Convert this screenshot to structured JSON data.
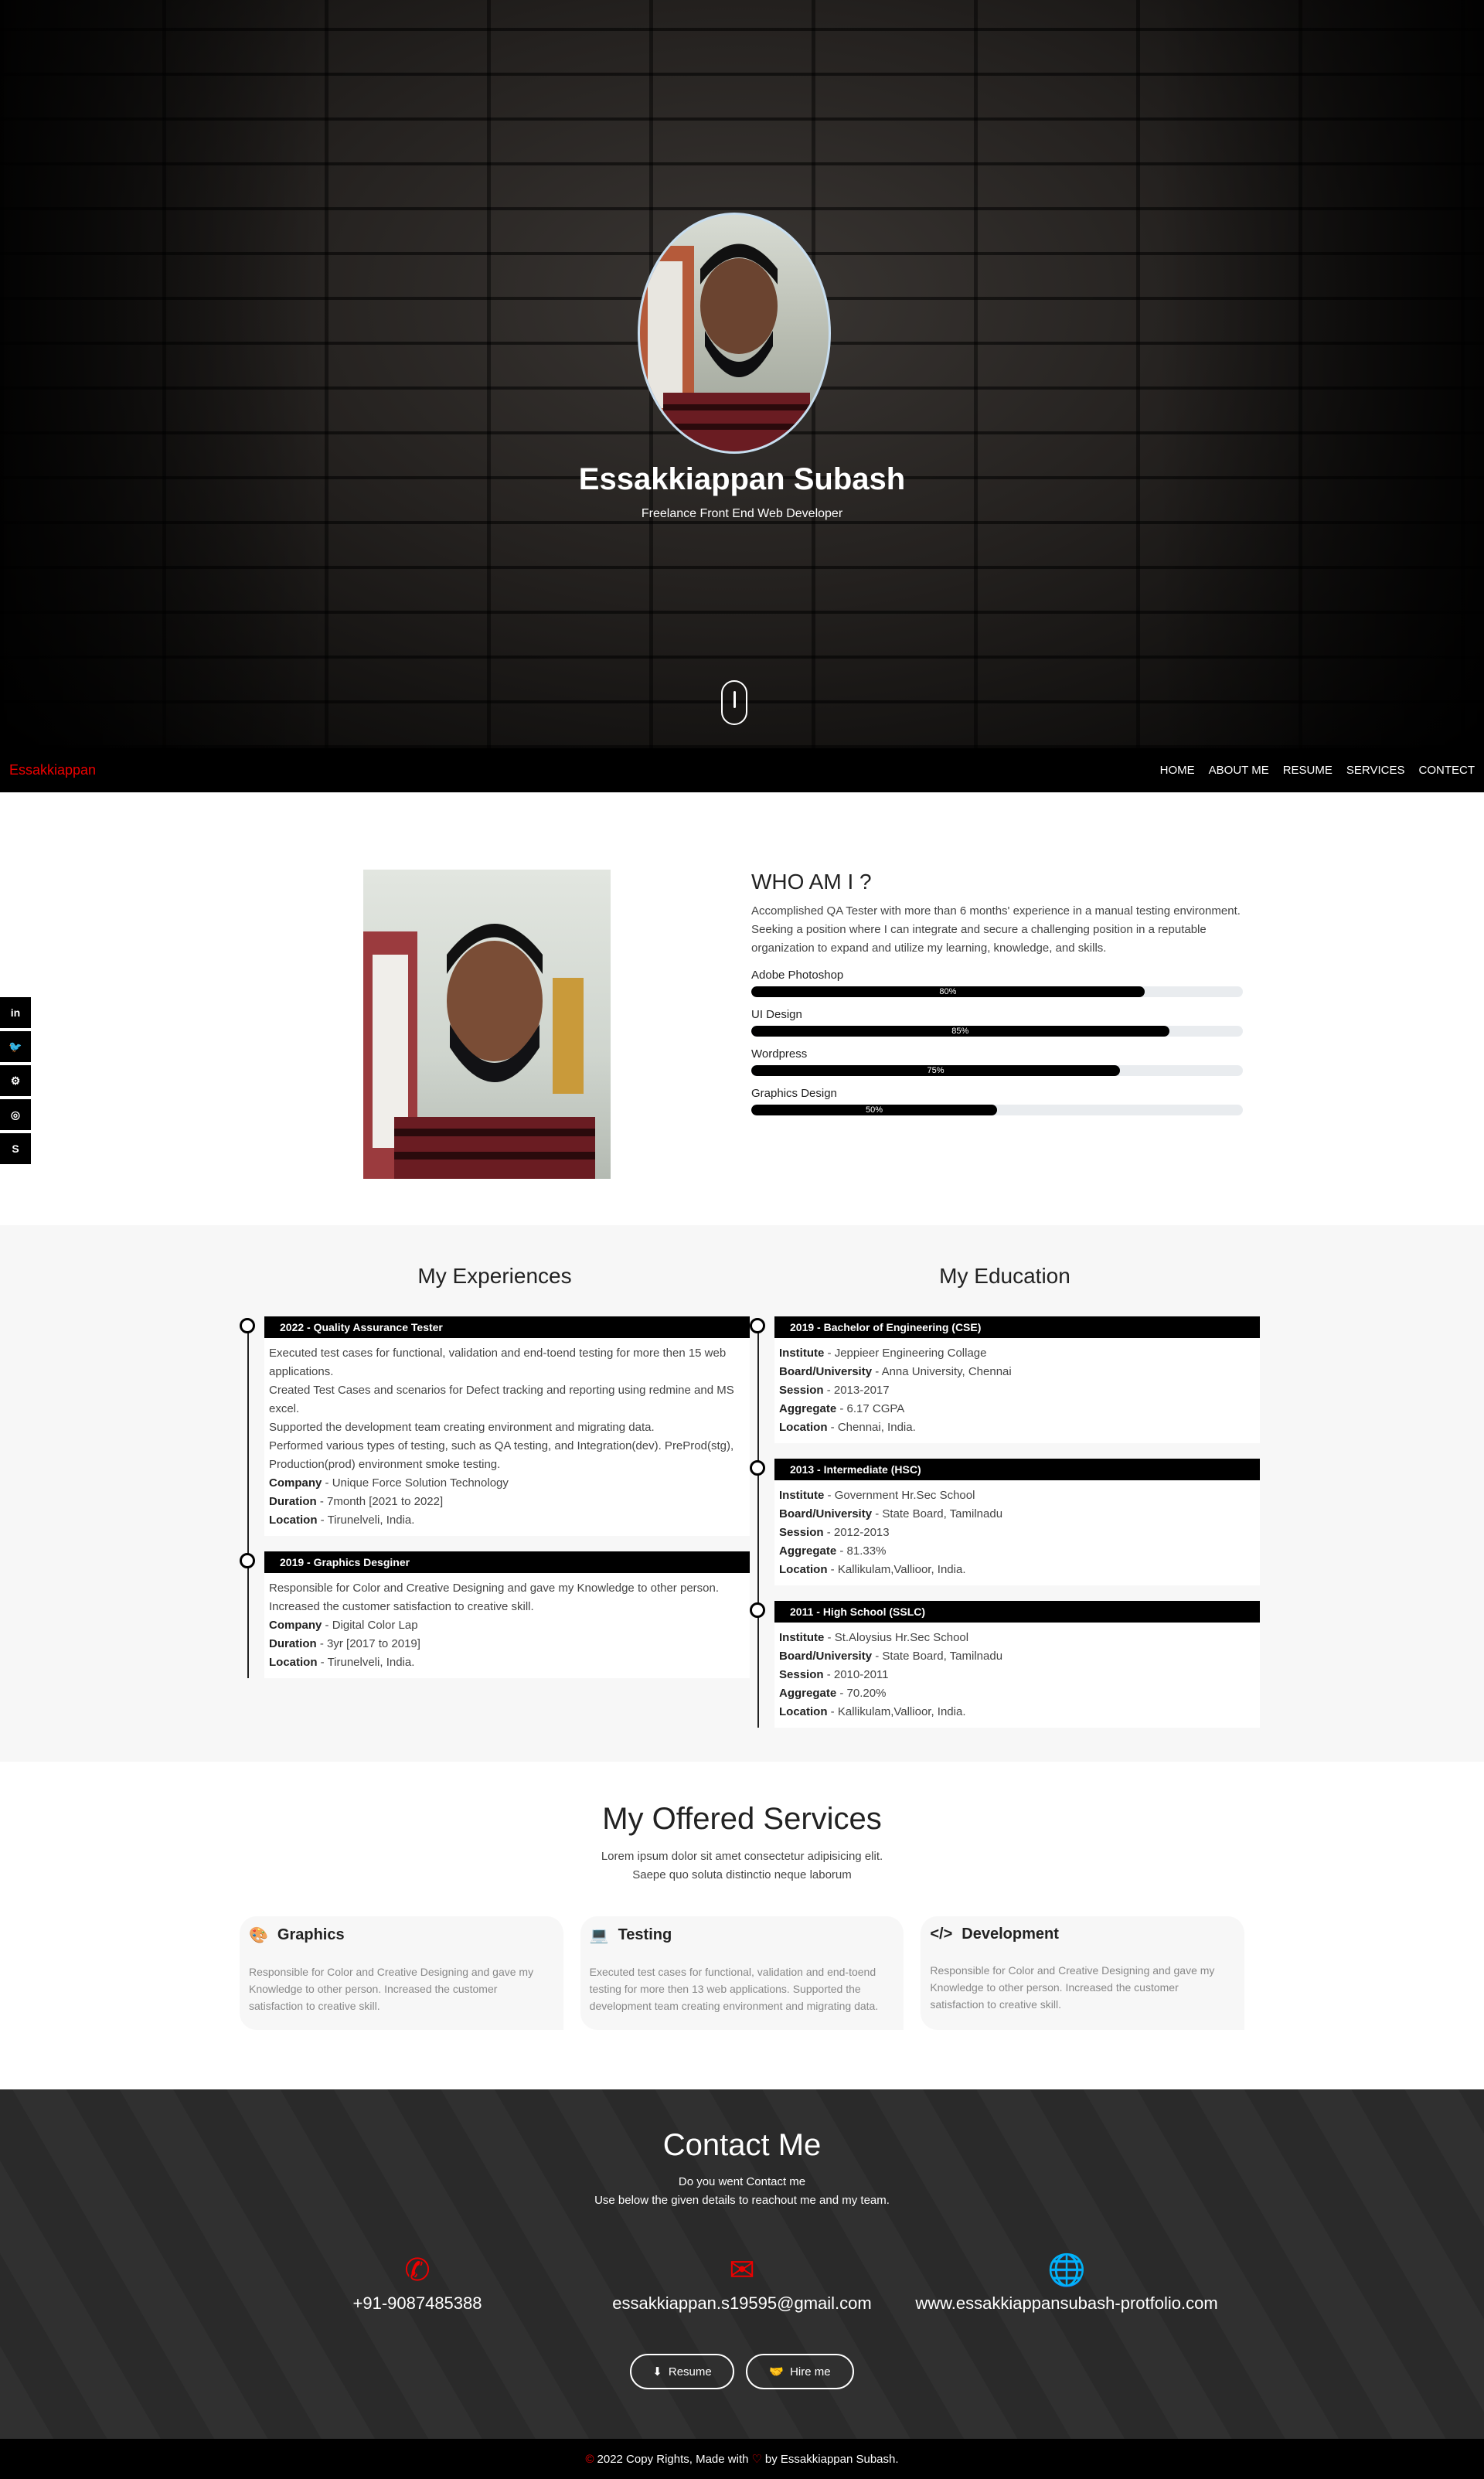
{
  "hero": {
    "name": "Essakkiappan Subash",
    "subtitle": "Freelance Front End Web Developer"
  },
  "nav": {
    "brand": "Essakkiappan",
    "links": [
      "HOME",
      "ABOUT ME",
      "RESUME",
      "SERVICES",
      "CONTECT"
    ]
  },
  "social_icons": [
    "linkedin-icon",
    "twitter-icon",
    "github-icon",
    "instagram-icon",
    "skype-icon"
  ],
  "about": {
    "heading": "WHO AM I ?",
    "paragraph": "Accomplished QA Tester with more than 6 months' experience in a manual testing environment. Seeking a position where I can integrate and secure a challenging position in a reputable organization to expand and utilize my learning, knowledge, and skills.",
    "skills": [
      {
        "name": "Adobe Photoshop",
        "percent": 80,
        "label": "80%"
      },
      {
        "name": "UI Design",
        "percent": 85,
        "label": "85%"
      },
      {
        "name": "Wordpress",
        "percent": 75,
        "label": "75%"
      },
      {
        "name": "Graphics Design",
        "percent": 50,
        "label": "50%"
      }
    ]
  },
  "experience": {
    "heading": "My Experiences",
    "items": [
      {
        "title": "2022 - Quality Assurance Tester",
        "desc": [
          "Executed test cases for functional, validation and end-toend testing for more then 15 web applications.",
          "Created Test Cases and scenarios for Defect tracking and reporting using redmine and MS excel.",
          "Supported the development team creating environment and migrating data.",
          "Performed various types of testing, such as QA testing, and Integration(dev). PreProd(stg), Production(prod) environment smoke testing."
        ],
        "company_label": "Company",
        "company": "Unique Force Solution Technology",
        "duration_label": "Duration",
        "duration": "7month [2021 to 2022]",
        "location_label": "Location",
        "location": "Tirunelveli, India."
      },
      {
        "title": "2019 - Graphics Desginer",
        "desc": [
          "Responsible for Color and Creative Designing and gave my Knowledge to other person.",
          "Increased the customer satisfaction to creative skill."
        ],
        "company_label": "Company",
        "company": "Digital Color Lap",
        "duration_label": "Duration",
        "duration": "3yr [2017 to 2019]",
        "location_label": "Location",
        "location": "Tirunelveli, India."
      }
    ]
  },
  "education": {
    "heading": "My Education",
    "items": [
      {
        "title": "2019 - Bachelor of Engineering (CSE)",
        "institute": "Jeppieer Engineering Collage",
        "board": "Anna University, Chennai",
        "session": "2013-2017",
        "aggregate": "6.17 CGPA",
        "location": "Chennai, India."
      },
      {
        "title": "2013 - Intermediate (HSC)",
        "institute": "Government Hr.Sec School",
        "board": "State Board, Tamilnadu",
        "session": "2012-2013",
        "aggregate": "81.33%",
        "location": "Kallikulam,Vallioor, India."
      },
      {
        "title": "2011 - High School (SSLC)",
        "institute": "St.Aloysius Hr.Sec School",
        "board": "State Board, Tamilnadu",
        "session": "2010-2011",
        "aggregate": "70.20%",
        "location": "Kallikulam,Vallioor, India."
      }
    ],
    "labels": {
      "institute": "Institute",
      "board": "Board/University",
      "session": "Session",
      "aggregate": "Aggregate",
      "location": "Location"
    }
  },
  "services": {
    "heading": "My Offered Services",
    "lead_1": "Lorem ipsum dolor sit amet consectetur adipisicing elit.",
    "lead_2": "Saepe quo soluta distinctio neque laborum",
    "cards": [
      {
        "icon": "palette-icon",
        "title": "Graphics",
        "text": "Responsible for Color and Creative Designing and gave my Knowledge to other person. Increased the customer satisfaction to creative skill."
      },
      {
        "icon": "laptop-icon",
        "title": "Testing",
        "text": "Executed test cases for functional, validation and end-toend testing for more then 13 web applications. Supported the development team creating environment and migrating data."
      },
      {
        "icon": "code-icon",
        "title": "Development",
        "text": "Responsible for Color and Creative Designing and gave my Knowledge to other person. Increased the customer satisfaction to creative skill."
      }
    ]
  },
  "contact": {
    "heading": "Contact Me",
    "sub_1": "Do you went Contact me",
    "sub_2": "Use below the given details to reachout me and my team.",
    "phone": "+91-9087485388",
    "email": "essakkiappan.s19595@gmail.com",
    "website": "www.essakkiappansubash-protfolio.com",
    "resume_button": "Resume",
    "hire_button": "Hire me"
  },
  "footer": {
    "text_1": "2022 Copy Rights, Made with",
    "text_2": "by Essakkiappan Subash."
  },
  "colors": {
    "accent": "#ee0000",
    "dark": "#000000",
    "section_bg": "#f7f7f7"
  }
}
